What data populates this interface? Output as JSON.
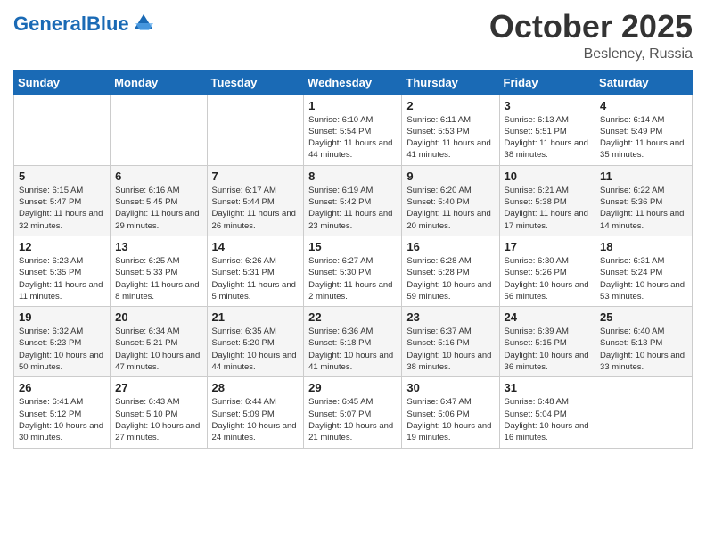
{
  "header": {
    "logo_text_general": "General",
    "logo_text_blue": "Blue",
    "month_title": "October 2025",
    "location": "Besleney, Russia"
  },
  "days_of_week": [
    "Sunday",
    "Monday",
    "Tuesday",
    "Wednesday",
    "Thursday",
    "Friday",
    "Saturday"
  ],
  "weeks": [
    [
      {
        "day": "",
        "sunrise": "",
        "sunset": "",
        "daylight": ""
      },
      {
        "day": "",
        "sunrise": "",
        "sunset": "",
        "daylight": ""
      },
      {
        "day": "",
        "sunrise": "",
        "sunset": "",
        "daylight": ""
      },
      {
        "day": "1",
        "sunrise": "Sunrise: 6:10 AM",
        "sunset": "Sunset: 5:54 PM",
        "daylight": "Daylight: 11 hours and 44 minutes."
      },
      {
        "day": "2",
        "sunrise": "Sunrise: 6:11 AM",
        "sunset": "Sunset: 5:53 PM",
        "daylight": "Daylight: 11 hours and 41 minutes."
      },
      {
        "day": "3",
        "sunrise": "Sunrise: 6:13 AM",
        "sunset": "Sunset: 5:51 PM",
        "daylight": "Daylight: 11 hours and 38 minutes."
      },
      {
        "day": "4",
        "sunrise": "Sunrise: 6:14 AM",
        "sunset": "Sunset: 5:49 PM",
        "daylight": "Daylight: 11 hours and 35 minutes."
      }
    ],
    [
      {
        "day": "5",
        "sunrise": "Sunrise: 6:15 AM",
        "sunset": "Sunset: 5:47 PM",
        "daylight": "Daylight: 11 hours and 32 minutes."
      },
      {
        "day": "6",
        "sunrise": "Sunrise: 6:16 AM",
        "sunset": "Sunset: 5:45 PM",
        "daylight": "Daylight: 11 hours and 29 minutes."
      },
      {
        "day": "7",
        "sunrise": "Sunrise: 6:17 AM",
        "sunset": "Sunset: 5:44 PM",
        "daylight": "Daylight: 11 hours and 26 minutes."
      },
      {
        "day": "8",
        "sunrise": "Sunrise: 6:19 AM",
        "sunset": "Sunset: 5:42 PM",
        "daylight": "Daylight: 11 hours and 23 minutes."
      },
      {
        "day": "9",
        "sunrise": "Sunrise: 6:20 AM",
        "sunset": "Sunset: 5:40 PM",
        "daylight": "Daylight: 11 hours and 20 minutes."
      },
      {
        "day": "10",
        "sunrise": "Sunrise: 6:21 AM",
        "sunset": "Sunset: 5:38 PM",
        "daylight": "Daylight: 11 hours and 17 minutes."
      },
      {
        "day": "11",
        "sunrise": "Sunrise: 6:22 AM",
        "sunset": "Sunset: 5:36 PM",
        "daylight": "Daylight: 11 hours and 14 minutes."
      }
    ],
    [
      {
        "day": "12",
        "sunrise": "Sunrise: 6:23 AM",
        "sunset": "Sunset: 5:35 PM",
        "daylight": "Daylight: 11 hours and 11 minutes."
      },
      {
        "day": "13",
        "sunrise": "Sunrise: 6:25 AM",
        "sunset": "Sunset: 5:33 PM",
        "daylight": "Daylight: 11 hours and 8 minutes."
      },
      {
        "day": "14",
        "sunrise": "Sunrise: 6:26 AM",
        "sunset": "Sunset: 5:31 PM",
        "daylight": "Daylight: 11 hours and 5 minutes."
      },
      {
        "day": "15",
        "sunrise": "Sunrise: 6:27 AM",
        "sunset": "Sunset: 5:30 PM",
        "daylight": "Daylight: 11 hours and 2 minutes."
      },
      {
        "day": "16",
        "sunrise": "Sunrise: 6:28 AM",
        "sunset": "Sunset: 5:28 PM",
        "daylight": "Daylight: 10 hours and 59 minutes."
      },
      {
        "day": "17",
        "sunrise": "Sunrise: 6:30 AM",
        "sunset": "Sunset: 5:26 PM",
        "daylight": "Daylight: 10 hours and 56 minutes."
      },
      {
        "day": "18",
        "sunrise": "Sunrise: 6:31 AM",
        "sunset": "Sunset: 5:24 PM",
        "daylight": "Daylight: 10 hours and 53 minutes."
      }
    ],
    [
      {
        "day": "19",
        "sunrise": "Sunrise: 6:32 AM",
        "sunset": "Sunset: 5:23 PM",
        "daylight": "Daylight: 10 hours and 50 minutes."
      },
      {
        "day": "20",
        "sunrise": "Sunrise: 6:34 AM",
        "sunset": "Sunset: 5:21 PM",
        "daylight": "Daylight: 10 hours and 47 minutes."
      },
      {
        "day": "21",
        "sunrise": "Sunrise: 6:35 AM",
        "sunset": "Sunset: 5:20 PM",
        "daylight": "Daylight: 10 hours and 44 minutes."
      },
      {
        "day": "22",
        "sunrise": "Sunrise: 6:36 AM",
        "sunset": "Sunset: 5:18 PM",
        "daylight": "Daylight: 10 hours and 41 minutes."
      },
      {
        "day": "23",
        "sunrise": "Sunrise: 6:37 AM",
        "sunset": "Sunset: 5:16 PM",
        "daylight": "Daylight: 10 hours and 38 minutes."
      },
      {
        "day": "24",
        "sunrise": "Sunrise: 6:39 AM",
        "sunset": "Sunset: 5:15 PM",
        "daylight": "Daylight: 10 hours and 36 minutes."
      },
      {
        "day": "25",
        "sunrise": "Sunrise: 6:40 AM",
        "sunset": "Sunset: 5:13 PM",
        "daylight": "Daylight: 10 hours and 33 minutes."
      }
    ],
    [
      {
        "day": "26",
        "sunrise": "Sunrise: 6:41 AM",
        "sunset": "Sunset: 5:12 PM",
        "daylight": "Daylight: 10 hours and 30 minutes."
      },
      {
        "day": "27",
        "sunrise": "Sunrise: 6:43 AM",
        "sunset": "Sunset: 5:10 PM",
        "daylight": "Daylight: 10 hours and 27 minutes."
      },
      {
        "day": "28",
        "sunrise": "Sunrise: 6:44 AM",
        "sunset": "Sunset: 5:09 PM",
        "daylight": "Daylight: 10 hours and 24 minutes."
      },
      {
        "day": "29",
        "sunrise": "Sunrise: 6:45 AM",
        "sunset": "Sunset: 5:07 PM",
        "daylight": "Daylight: 10 hours and 21 minutes."
      },
      {
        "day": "30",
        "sunrise": "Sunrise: 6:47 AM",
        "sunset": "Sunset: 5:06 PM",
        "daylight": "Daylight: 10 hours and 19 minutes."
      },
      {
        "day": "31",
        "sunrise": "Sunrise: 6:48 AM",
        "sunset": "Sunset: 5:04 PM",
        "daylight": "Daylight: 10 hours and 16 minutes."
      },
      {
        "day": "",
        "sunrise": "",
        "sunset": "",
        "daylight": ""
      }
    ]
  ]
}
